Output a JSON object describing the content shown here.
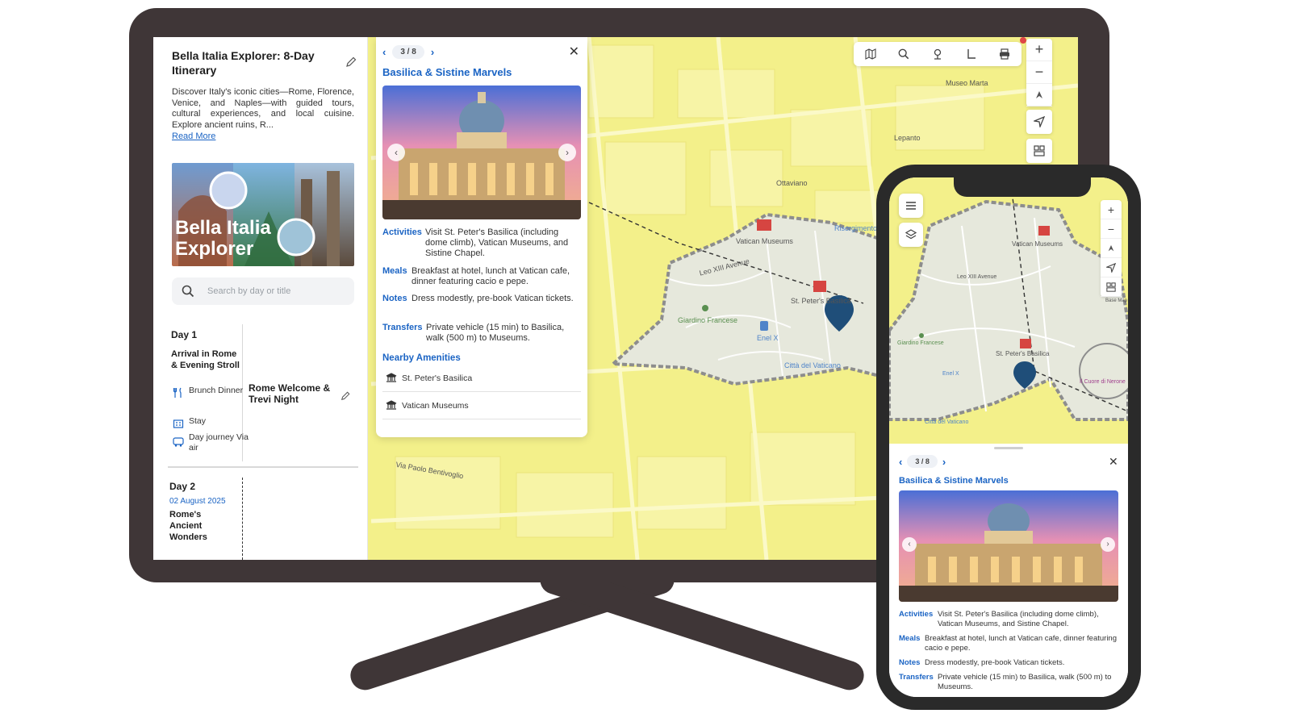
{
  "itinerary": {
    "title": "Bella Italia Explorer: 8-Day Itinerary",
    "description": "Discover Italy's iconic cities—Rome, Florence, Venice, and Naples—with guided tours, cultural experiences, and local cuisine. Explore ancient ruins, R...",
    "read_more": "Read More",
    "cover_title_line1": "Bella Italia",
    "cover_title_line2": "Explorer",
    "search_placeholder": "Search by day or title",
    "day1": {
      "label": "Day 1",
      "subtitle": "Arrival in Rome & Evening Stroll",
      "meals": "Brunch Dinner",
      "stay": "Stay",
      "transport": "Day journey Via air",
      "title": "Rome Welcome & Trevi Night"
    },
    "day2": {
      "label": "Day 2",
      "date": "02 August 2025",
      "subtitle": "Rome's Ancient Wonders"
    }
  },
  "popup": {
    "pager": "3 / 8",
    "title": "Basilica & Sistine Marvels",
    "activities_label": "Activities",
    "activities": "Visit St. Peter's Basilica (including dome climb), Vatican Museums, and Sistine Chapel.",
    "meals_label": "Meals",
    "meals": "Breakfast at hotel, lunch at Vatican cafe, dinner featuring cacio e pepe.",
    "notes_label": "Notes",
    "notes": "Dress modestly, pre-book Vatican tickets.",
    "transfers_label": "Transfers",
    "transfers": "Private vehicle (15 min) to Basilica, walk (500 m) to Museums.",
    "nearby_heading": "Nearby Amenities",
    "nearby": [
      "St. Peter's Basilica",
      "Vatican Museums"
    ]
  },
  "map": {
    "labels": {
      "vatican_museums": "Vatican Museums",
      "st_peters": "St. Peter's Basilica",
      "giardino": "Giardino Francese",
      "enel": "Enel X",
      "citta": "Città del Vaticano",
      "risorgimento": "Risorgimento - S. Pietro",
      "leo": "Leo XIII Avenue",
      "ottaviano": "Ottaviano",
      "lepanto": "Lepanto",
      "bentivoglio": "Via Paolo Bentivoglio",
      "museo": "Museo Marta"
    }
  },
  "phone": {
    "map_labels": {
      "vatican_museums": "Vatican Museums",
      "leo": "Leo XIII Avenue",
      "giardino": "Giardino Francese",
      "st_peters": "St. Peter's Basilica",
      "enel": "Enel X",
      "cuore": "Il Cuore di Nerone",
      "citta": "Città del Vaticano",
      "base": "Base Map"
    },
    "pager": "3 / 8",
    "title": "Basilica & Sistine Marvels",
    "activities_label": "Activities",
    "activities": "Visit St. Peter's Basilica (including dome climb), Vatican Museums, and Sistine Chapel.",
    "meals_label": "Meals",
    "meals": "Breakfast at hotel, lunch at Vatican cafe, dinner featuring cacio e pepe.",
    "notes_label": "Notes",
    "notes": "Dress modestly, pre-book Vatican tickets.",
    "transfers_label": "Transfers",
    "transfers": "Private vehicle (15 min) to Basilica, walk (500 m) to Museums."
  },
  "colors": {
    "accent": "#1b64c4",
    "map_base": "#f3f08a",
    "vatican_area": "#e6e8dc",
    "device_frame": "#3f3637",
    "marker": "#1f4e79",
    "landmark_red": "#d64541"
  },
  "icons": [
    "edit-icon",
    "search-icon",
    "fork-knife-icon",
    "hotel-icon",
    "bus-icon",
    "close-icon",
    "chevron-left-icon",
    "chevron-right-icon",
    "bank-icon",
    "map-icon",
    "pin-icon",
    "foot-icon",
    "print-icon",
    "plus-icon",
    "minus-icon",
    "compass-icon",
    "locate-icon",
    "layers-icon",
    "menu-icon"
  ]
}
